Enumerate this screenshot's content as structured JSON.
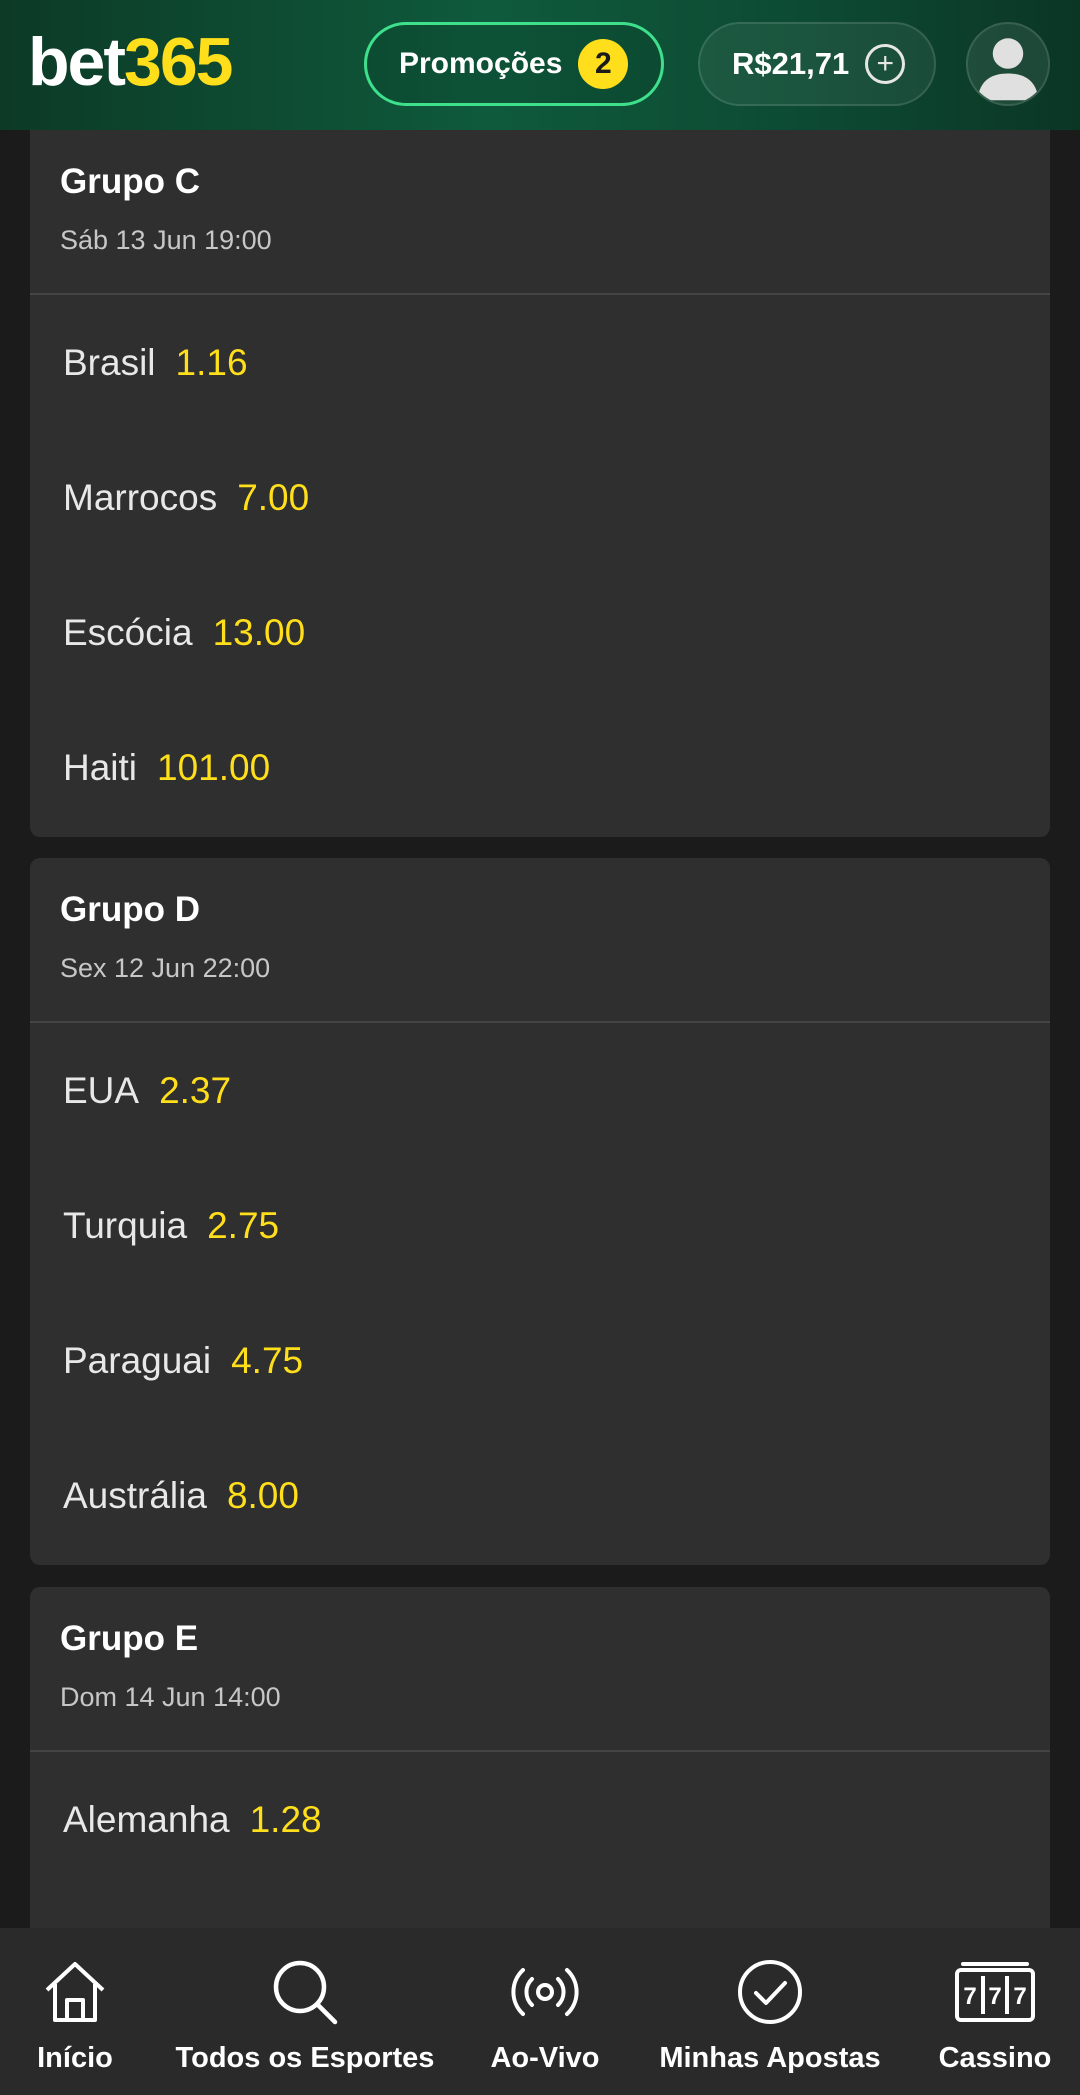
{
  "header": {
    "logo_bet": "bet",
    "logo_num": "365",
    "promo_label": "Promoções",
    "promo_count": "2",
    "balance": "R$21,71",
    "plus_icon": "plus-circle-icon",
    "avatar_icon": "user-icon"
  },
  "groups": [
    {
      "title": "Grupo C",
      "date": "Sáb 13 Jun 19:00",
      "teams": [
        {
          "name": "Brasil",
          "odd": "1.16"
        },
        {
          "name": "Marrocos",
          "odd": "7.00"
        },
        {
          "name": "Escócia",
          "odd": "13.00"
        },
        {
          "name": "Haiti",
          "odd": "101.00"
        }
      ]
    },
    {
      "title": "Grupo D",
      "date": "Sex 12 Jun 22:00",
      "teams": [
        {
          "name": "EUA",
          "odd": "2.37"
        },
        {
          "name": "Turquia",
          "odd": "2.75"
        },
        {
          "name": "Paraguai",
          "odd": "4.75"
        },
        {
          "name": "Austrália",
          "odd": "8.00"
        }
      ]
    },
    {
      "title": "Grupo E",
      "date": "Dom 14 Jun 14:00",
      "teams": [
        {
          "name": "Alemanha",
          "odd": "1.28"
        }
      ]
    }
  ],
  "nav": [
    {
      "label": "Início",
      "icon": "home-icon"
    },
    {
      "label": "Todos os Esportes",
      "icon": "search-icon"
    },
    {
      "label": "Ao-Vivo",
      "icon": "live-broadcast-icon"
    },
    {
      "label": "Minhas Apostas",
      "icon": "check-circle-icon"
    },
    {
      "label": "Cassino",
      "icon": "slot-machine-icon"
    }
  ],
  "colors": {
    "accent_yellow": "#ffdf1b",
    "header_green": "#0f5a3c",
    "promo_border": "#3ee08c",
    "card_bg": "#2f2f2f",
    "page_bg": "#1b1b1b"
  }
}
